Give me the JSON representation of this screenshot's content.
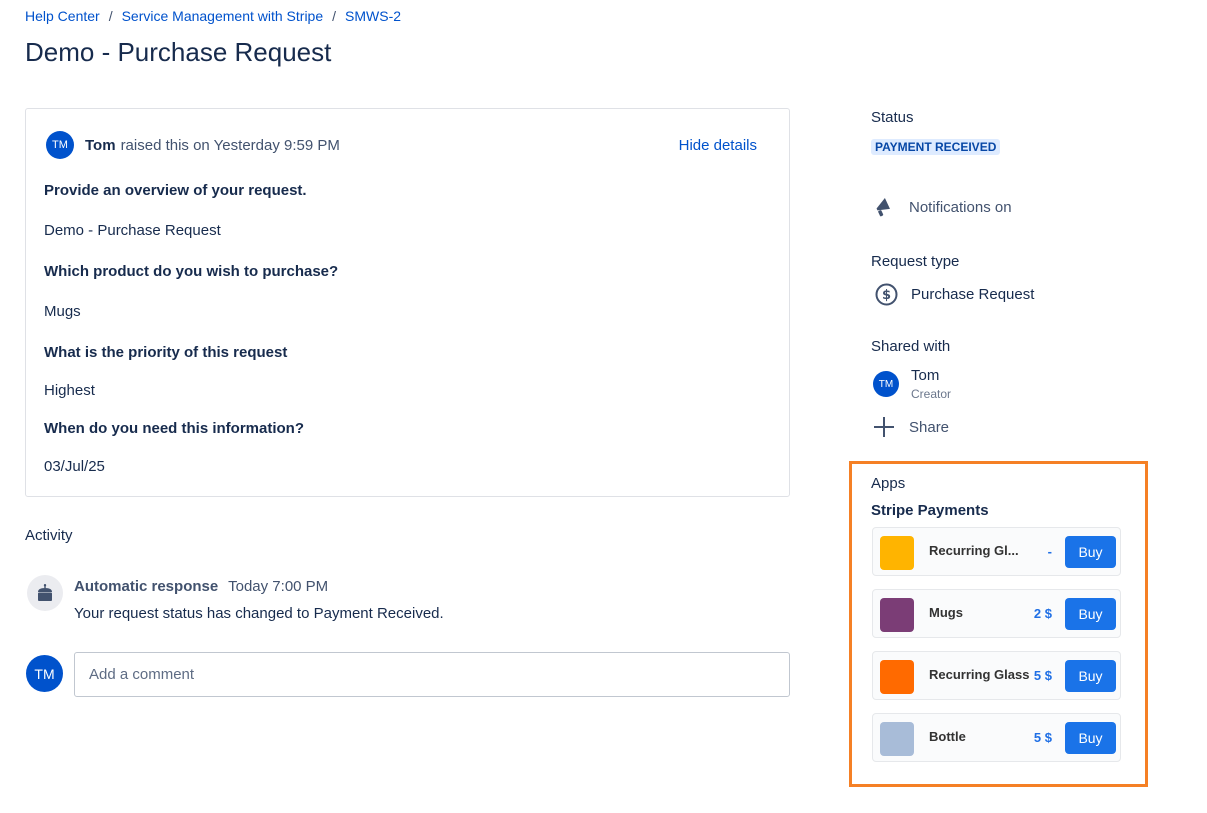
{
  "breadcrumb": {
    "items": [
      "Help Center",
      "Service Management with Stripe",
      "SMWS-2"
    ],
    "separator": "/"
  },
  "page_title": "Demo - Purchase Request",
  "request": {
    "author_initials": "TM",
    "author": "Tom",
    "raised_text": "raised this on Yesterday 9:59 PM",
    "hide_details": "Hide details",
    "fields": [
      {
        "q": "Provide an overview of your request.",
        "a": "Demo - Purchase Request"
      },
      {
        "q": "Which product do you wish to purchase?",
        "a": "Mugs"
      },
      {
        "q": "What is the priority of this request",
        "a": "Highest"
      },
      {
        "q": "When do you need this information?",
        "a": "03/Jul/25"
      }
    ]
  },
  "activity": {
    "title": "Activity",
    "entries": [
      {
        "who": "Automatic response",
        "when": "Today 7:00 PM",
        "text": "Your request status has changed to Payment Received."
      }
    ],
    "comment_initials": "TM",
    "comment_placeholder": "Add a comment"
  },
  "sidebar": {
    "status_label": "Status",
    "status_value": "PAYMENT RECEIVED",
    "notifications": "Notifications on",
    "request_type_label": "Request type",
    "request_type_value": "Purchase Request",
    "shared_label": "Shared with",
    "shared_user": {
      "initials": "TM",
      "name": "Tom",
      "role": "Creator"
    },
    "share_label": "Share",
    "apps_label": "Apps",
    "stripe_label": "Stripe Payments",
    "products": [
      {
        "name": "Recurring Gl...",
        "price": "-",
        "color": "#ffb400",
        "buy": "Buy"
      },
      {
        "name": "Mugs",
        "price": "2 $",
        "color": "#7b3d76",
        "buy": "Buy"
      },
      {
        "name": "Recurring Glass",
        "price": "5 $",
        "color": "#ff6a00",
        "buy": "Buy"
      },
      {
        "name": "Bottle",
        "price": "5 $",
        "color": "#a8bcd8",
        "buy": "Buy"
      }
    ]
  },
  "colors": {
    "link": "#0052cc",
    "highlight_border": "#f58025",
    "buy_button": "#1a73e8",
    "status_badge_bg": "#deebff"
  }
}
